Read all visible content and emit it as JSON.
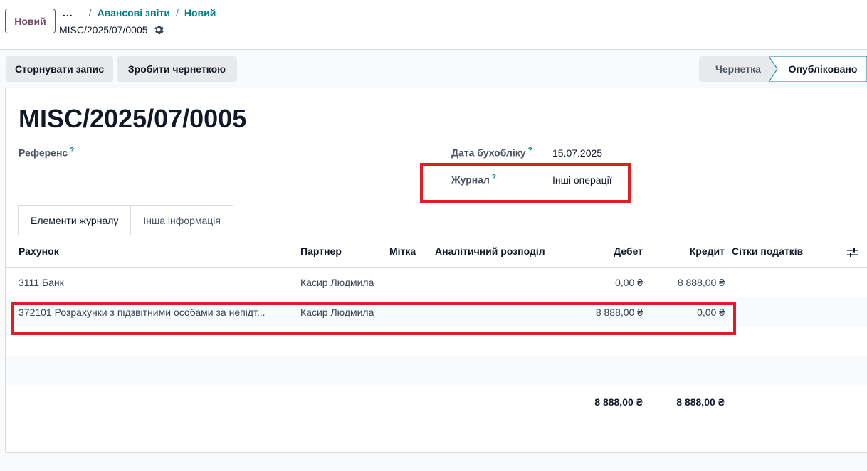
{
  "control": {
    "new_button": "Новий",
    "breadcrumb_dots": "...",
    "breadcrumb_parent": "Авансові звіти",
    "breadcrumb_current": "Новий",
    "record_name": "MISC/2025/07/0005"
  },
  "actions": {
    "reverse": "Сторнувати запис",
    "reset_draft": "Зробити чернеткою"
  },
  "statusbar": {
    "draft": "Чернетка",
    "posted": "Опубліковано",
    "active": "posted"
  },
  "form": {
    "title": "MISC/2025/07/0005",
    "reference_label": "Референс",
    "date_label": "Дата бухобліку",
    "date_value": "15.07.2025",
    "journal_label": "Журнал",
    "journal_value": "Інші операції",
    "help_mark": "?"
  },
  "tabs": [
    "Елементи журналу",
    "Інша інформація"
  ],
  "lines": {
    "columns": {
      "account": "Рахунок",
      "partner": "Партнер",
      "label": "Мітка",
      "analytic": "Аналітичний розподіл",
      "debit": "Дебет",
      "credit": "Кредит",
      "tax_grids": "Сітки податків"
    },
    "rows": [
      {
        "account": "3111 Банк",
        "partner": "Касир Людмила",
        "debit": "0,00 ₴",
        "credit": "8 888,00 ₴"
      },
      {
        "account": "372101 Розрахунки з підзвітними особами за непідт...",
        "partner": "Касир Людмила",
        "debit": "8 888,00 ₴",
        "credit": "0,00 ₴"
      }
    ],
    "totals": {
      "debit": "8 888,00 ₴",
      "credit": "8 888,00 ₴"
    }
  },
  "colors": {
    "brand": "#714b67",
    "link": "#017e84",
    "highlight": "#e11d24"
  }
}
